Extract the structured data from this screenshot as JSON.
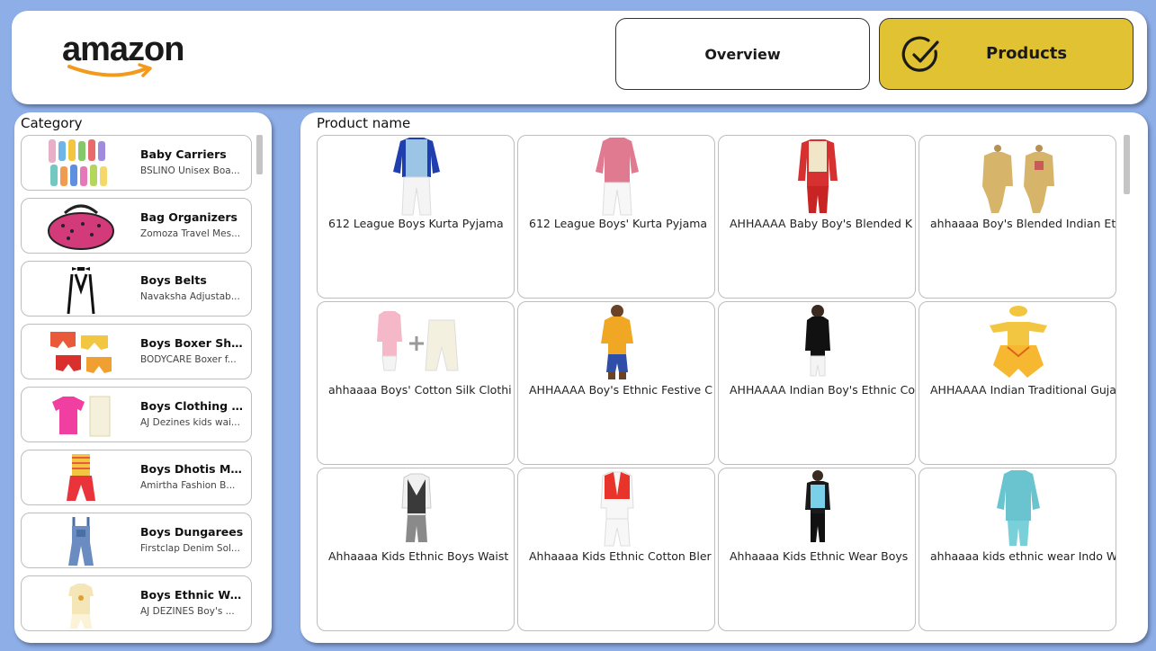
{
  "header": {
    "logo_text": "amazon",
    "nav": {
      "overview_label": "Overview",
      "products_label": "Products"
    },
    "colors": {
      "active": "#e1c233",
      "background": "#8eaee8"
    }
  },
  "category": {
    "title": "Category",
    "items": [
      {
        "name": "Baby Carriers",
        "sub": "BSLINO Unisex Boa..."
      },
      {
        "name": "Bag Organizers",
        "sub": "Zomoza Travel Mes..."
      },
      {
        "name": "Boys Belts",
        "sub": "Navaksha Adjustab..."
      },
      {
        "name": "Boys Boxer Sho...",
        "sub": "BODYCARE Boxer f..."
      },
      {
        "name": "Boys Clothing S...",
        "sub": "AJ Dezines kids wai..."
      },
      {
        "name": "Boys Dhotis Mu...",
        "sub": "Amirtha Fashion B..."
      },
      {
        "name": "Boys Dungarees",
        "sub": "Firstclap Denim Sol..."
      },
      {
        "name": "Boys Ethnic We...",
        "sub": "AJ DEZINES Boy's ..."
      }
    ]
  },
  "products": {
    "title": "Product name",
    "items": [
      {
        "name": "612 League Boys Kurta Pyjama"
      },
      {
        "name": "612 League Boys' Kurta Pyjama"
      },
      {
        "name": "AHHAAAA Baby Boy's Blended K"
      },
      {
        "name": "ahhaaaa Boy's Blended Indian Et"
      },
      {
        "name": "ahhaaaa Boys' Cotton Silk Clothi"
      },
      {
        "name": "AHHAAAA Boy's Ethnic Festive C"
      },
      {
        "name": "AHHAAAA Indian Boy's Ethnic Co"
      },
      {
        "name": "AHHAAAA Indian Traditional Guja"
      },
      {
        "name": "Ahhaaaa Kids Ethnic Boys Waist"
      },
      {
        "name": "Ahhaaaa Kids Ethnic Cotton Bler"
      },
      {
        "name": "Ahhaaaa Kids Ethnic Wear Boys"
      },
      {
        "name": "ahhaaaa kids ethnic wear Indo W"
      }
    ]
  }
}
